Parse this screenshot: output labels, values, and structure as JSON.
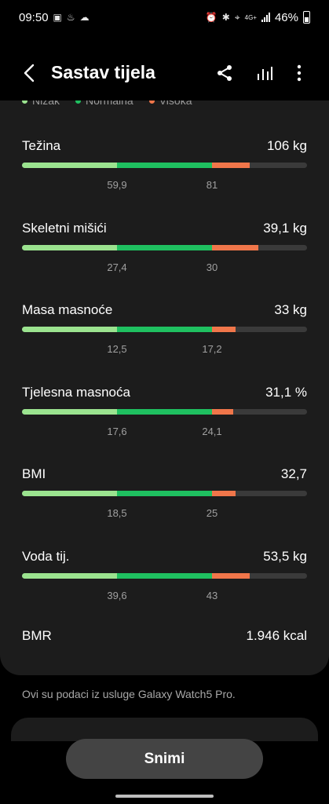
{
  "status": {
    "time": "09:50",
    "network": "4G+",
    "battery": "46%"
  },
  "header": {
    "title": "Sastav tijela"
  },
  "legend": [
    {
      "label": "Nizak",
      "color": "#9be38f"
    },
    {
      "label": "Normalna",
      "color": "#1fc060"
    },
    {
      "label": "Visoka",
      "color": "#f0764a"
    }
  ],
  "metrics": [
    {
      "name": "Težina",
      "value": "106 kg",
      "low": "59,9",
      "high": "81",
      "fill_end": 0.8
    },
    {
      "name": "Skeletni mišići",
      "value": "39,1 kg",
      "low": "27,4",
      "high": "30",
      "fill_end": 0.83
    },
    {
      "name": "Masa masnoće",
      "value": "33 kg",
      "low": "12,5",
      "high": "17,2",
      "fill_end": 0.75
    },
    {
      "name": "Tjelesna masnoća",
      "value": "31,1 %",
      "low": "17,6",
      "high": "24,1",
      "fill_end": 0.74
    },
    {
      "name": "BMI",
      "value": "32,7",
      "low": "18,5",
      "high": "25",
      "fill_end": 0.75
    },
    {
      "name": "Voda tij.",
      "value": "53,5 kg",
      "low": "39,6",
      "high": "43",
      "fill_end": 0.8
    }
  ],
  "bmr": {
    "name": "BMR",
    "value": "1.946 kcal"
  },
  "footnote": "Ovi su podaci iz usluge Galaxy Watch5 Pro.",
  "record_button": "Snimi"
}
